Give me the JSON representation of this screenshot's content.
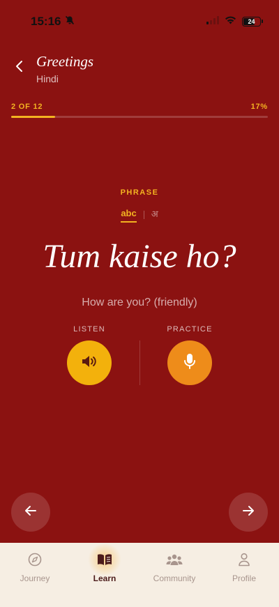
{
  "status_bar": {
    "time": "15:16",
    "battery": "24"
  },
  "header": {
    "title": "Greetings",
    "language": "Hindi"
  },
  "progress": {
    "step_text": "2 OF 12",
    "percent_text": "17%",
    "fraction": 0.17
  },
  "phrase": {
    "section_label": "PHRASE",
    "script_latin": "abc",
    "script_devanagari": "अ",
    "text": "Tum kaise ho?",
    "translation": "How are you? (friendly)"
  },
  "actions": {
    "listen_label": "LISTEN",
    "practice_label": "PRACTICE"
  },
  "tabs": [
    {
      "label": "Journey",
      "icon": "compass-icon",
      "active": false
    },
    {
      "label": "Learn",
      "icon": "book-icon",
      "active": true
    },
    {
      "label": "Community",
      "icon": "people-icon",
      "active": false
    },
    {
      "label": "Profile",
      "icon": "person-icon",
      "active": false
    }
  ],
  "colors": {
    "background": "#8B1211",
    "accent": "#F3B321",
    "listen": "#F3B10C",
    "practice": "#EE8C1A",
    "tab_bar": "#F6EEE3"
  }
}
